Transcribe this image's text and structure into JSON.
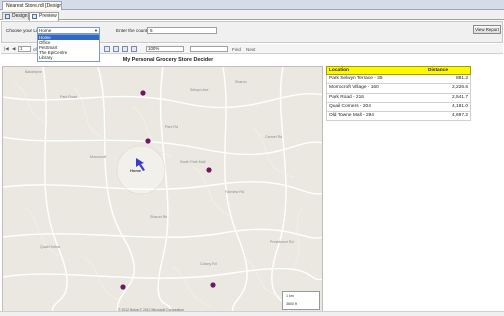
{
  "document_tab": "Nearest Store.rdl [Design]",
  "view_tabs": [
    {
      "label": "Design",
      "active": false
    },
    {
      "label": "Preview",
      "active": true
    }
  ],
  "parameters": {
    "location_label": "Choose your Location",
    "location_value": "Home",
    "location_options": [
      "Home",
      "Office",
      "PetSmart",
      "The EpiCentre",
      "Library"
    ],
    "count_label": "Enter the count:",
    "count_value": "5",
    "view_report_label": "View Report"
  },
  "toolbar": {
    "page_current": "1",
    "page_of": "of",
    "page_total": "1",
    "zoom": "100%",
    "find_label": "Find",
    "next_label": "Next"
  },
  "report": {
    "title": "My Personal Grocery Store Decider",
    "home_label": "Home",
    "copyright": "© 2012 Nokia  © 2012 Microsoft Corporation",
    "scale_km": "1 km",
    "scale_ft": "3600 ft",
    "map_labels": [
      "Ballantyne",
      "Park Road",
      "Sharon",
      "South Park Mall",
      "Morrocroft",
      "Quail Hollow",
      "Carmel Rd",
      "Park Rd",
      "Colony Rd",
      "Fairview Rd",
      "Sharon Rd",
      "Providence Rd",
      "Selwyn Ave"
    ],
    "table_headers": [
      "Location",
      "Distance"
    ],
    "table_rows": [
      {
        "location": "Park Selwyn Terrace - 35",
        "distance": "881.2"
      },
      {
        "location": "Morrocroft Village - 160",
        "distance": "2,226.6"
      },
      {
        "location": "Park Road - 216",
        "distance": "2,541.7"
      },
      {
        "location": "Quail Corners - 204",
        "distance": "4,191.0"
      },
      {
        "location": "Old Towne Mall - 294",
        "distance": "4,697.2"
      }
    ],
    "colors": {
      "header_bg": "#fff700",
      "store_marker": "#6b1a60",
      "home_marker": "#3a3ad0"
    }
  }
}
